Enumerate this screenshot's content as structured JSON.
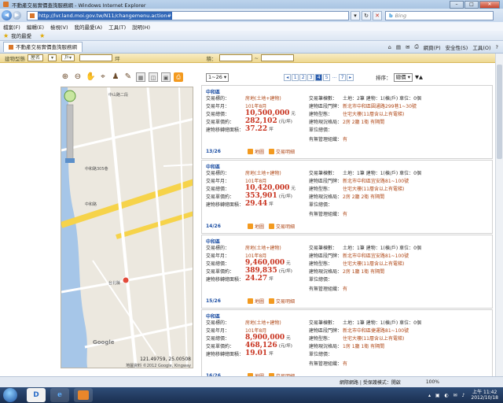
{
  "window": {
    "title": "不動產交易實價查詢服務網 - Windows Internet Explorer"
  },
  "address_bar": {
    "url": "http://lvr.land.moi.gov.tw/N11/changemenu.action#",
    "search_placeholder": "Bing"
  },
  "menu": [
    "檔案(F)",
    "編輯(E)",
    "檢視(V)",
    "我的最愛(A)",
    "工具(T)",
    "說明(H)"
  ],
  "favorites": {
    "label": "我的最愛"
  },
  "tab": {
    "label": "不動產交易實價查詢服務網"
  },
  "toolbar": {
    "page_label": "網頁(P)",
    "safety_label": "安全性(S)",
    "tools_label": "工具(O)",
    "help_label": "?"
  },
  "filter_bar": {
    "left_label": "建物型態",
    "select1": "屋名",
    "select2": "▾",
    "select3": "戶▾",
    "unit": "坪",
    "area_label": "積："
  },
  "pager": {
    "range": "1~26",
    "pages": [
      "1",
      "2",
      "3",
      "4",
      "5",
      "...",
      "7"
    ],
    "current": "4",
    "sort_label": "排序：",
    "sort_value": "總價"
  },
  "map": {
    "coordinates": "121.49759, 25.00508",
    "copyright": "地圖資料 ©2012 Google, Kingway",
    "logo": "Google",
    "labels": [
      "中和路",
      "中和路305巷",
      "中和路",
      "台北縣",
      "中山路二段"
    ]
  },
  "field_labels": {
    "type": "交易標的：",
    "date": "交易年月：",
    "total": "交易總價：",
    "unit_price": "交易單價約：",
    "area": "建物移轉總面積：",
    "content": "交易筆棟數：",
    "address": "建物區段門牌：",
    "building_type": "建物型態：",
    "layout": "建物現況格局：",
    "remarks": "單位總價：",
    "management": "有無管理組織："
  },
  "units": {
    "yuan": "元",
    "per_ping": "(元/坪)",
    "ping": "坪"
  },
  "actions": {
    "map": "地圖",
    "detail": "交易明細"
  },
  "listings": [
    {
      "district": "中和區",
      "type": "房地(土地+建物)",
      "date": "101年8月",
      "total": "10,500,000",
      "unit_price": "282,102",
      "area": "37.22",
      "index": "13/26",
      "content": "土地：2筆 建物：1(棟/戶) 車位：0個",
      "address": "新北市中和區圓通路299巷1~30號",
      "building_type": "住宅大樓(11層含以上有電梯)",
      "layout": "2房 2廳 1衛 有隔間",
      "remarks": "",
      "management": "有"
    },
    {
      "district": "中和區",
      "type": "房地(土地+建物)",
      "date": "101年8月",
      "total": "10,420,000",
      "unit_price": "353,901",
      "area": "29.44",
      "index": "14/26",
      "content": "土地：1筆 建物：1(棟/戶) 車位：0個",
      "address": "新北市中和區宜安路81~100號",
      "building_type": "住宅大樓(11層含以上有電梯)",
      "layout": "2房 2廳 2衛 有隔間",
      "remarks": "",
      "management": "有"
    },
    {
      "district": "中和區",
      "type": "房地(土地+建物)",
      "date": "101年8月",
      "total": "9,460,000",
      "unit_price": "389,835",
      "area": "24.27",
      "index": "15/26",
      "content": "土地：1筆 建物：1(棟/戶) 車位：0個",
      "address": "新北市中和區宜安路81~100號",
      "building_type": "住宅大樓(11層含以上有電梯)",
      "layout": "2房 1廳 1衛 有隔間",
      "remarks": "",
      "management": "有"
    },
    {
      "district": "中和區",
      "type": "房地(土地+建物)",
      "date": "101年8月",
      "total": "8,900,000",
      "unit_price": "468,126",
      "area": "19.01",
      "index": "16/26",
      "content": "土地：1筆 建物：1(棟/戶) 車位：0個",
      "address": "新北市中和區捷運路81~100號",
      "building_type": "住宅大樓(11層含以上有電梯)",
      "layout": "1房 1廳 1衛 有隔間",
      "remarks": "",
      "management": "有"
    }
  ],
  "status_bar": {
    "zone": "網際網路 | 受保護模式：開啟",
    "zoom": "100%"
  },
  "taskbar": {
    "time": "上午 11:42",
    "date": "2012/10/18"
  },
  "colors": {
    "accent": "#c8321e",
    "link": "#1d4fa3",
    "filter_bar": "#eed892",
    "map_road": "#f6d34a"
  }
}
